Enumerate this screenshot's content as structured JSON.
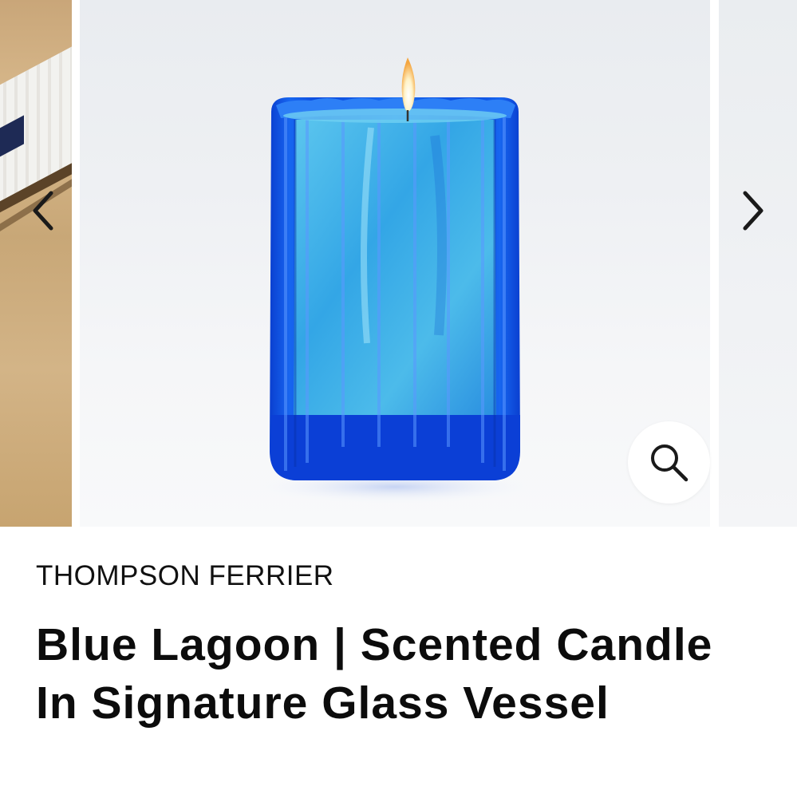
{
  "product": {
    "brand": "THOMPSON FERRIER",
    "title": "Blue Lagoon | Scented Candle In Signature Glass Vessel"
  },
  "gallery": {
    "prev_icon": "chevron-left-icon",
    "next_icon": "chevron-right-icon",
    "zoom_icon": "magnifier-icon",
    "main_image": "blue ribbed glass candle, lit"
  },
  "colors": {
    "glass": "#0d4fe0",
    "wax": "#3fb6e8",
    "text": "#111111"
  }
}
